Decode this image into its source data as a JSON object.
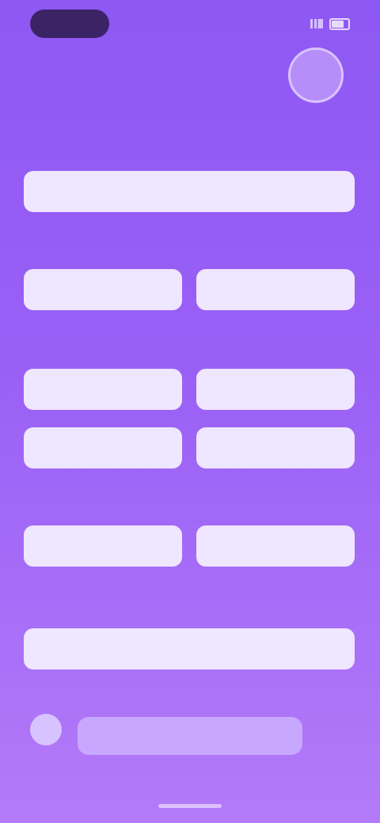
{
  "status_bar": {
    "pill_text": "",
    "right_text": ""
  },
  "header": {
    "title": "",
    "avatar_initials": ""
  },
  "sections": {
    "label_1": "",
    "field_1": "",
    "label_2": "",
    "field_2a": "",
    "field_2b": "",
    "label_3": "",
    "field_3a": "",
    "field_3b": "",
    "field_3c": "",
    "field_3d": "",
    "label_4": "",
    "field_4a": "",
    "field_4b": "",
    "label_5": "",
    "field_5": ""
  },
  "bottom": {
    "circle_icon": "",
    "primary_button_label": ""
  },
  "colors": {
    "background_top": "#8e58f4",
    "background_bottom": "#b37af9",
    "field_bg": "#efe6ff",
    "title_accent": "#f7b07a",
    "pill_bg": "#3a2466"
  }
}
